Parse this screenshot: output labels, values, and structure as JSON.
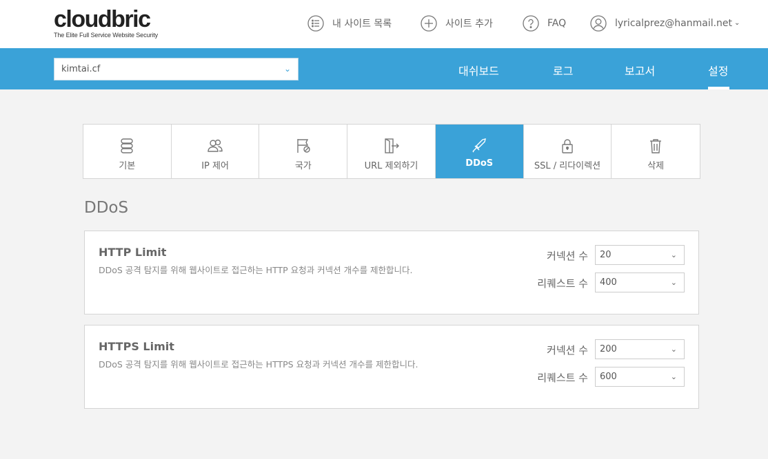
{
  "logo": {
    "word": "cloudbric",
    "tagline": "The Elite Full Service Website Security"
  },
  "top_nav": {
    "my_sites": "내 사이트 목록",
    "add_site": "사이트 추가",
    "faq": "FAQ",
    "user_email": "lyricalprez@hanmail.net"
  },
  "site_select": {
    "value": "kimtai.cf"
  },
  "main_nav": {
    "dashboard": "대쉬보드",
    "log": "로그",
    "report": "보고서",
    "settings": "설정"
  },
  "tabs": [
    {
      "label": "기본",
      "icon": "database-icon"
    },
    {
      "label": "IP 제어",
      "icon": "users-icon"
    },
    {
      "label": "국가",
      "icon": "flag-block-icon"
    },
    {
      "label": "URL 제외하기",
      "icon": "exit-door-icon"
    },
    {
      "label": "DDoS",
      "icon": "sword-icon",
      "active": true
    },
    {
      "label": "SSL / 리다이렉션",
      "icon": "lock-icon"
    },
    {
      "label": "삭제",
      "icon": "trash-icon"
    }
  ],
  "section_title": "DDoS",
  "panels": {
    "http": {
      "title": "HTTP Limit",
      "description": "DDoS 공격 탐지를 위해 웹사이트로 접근하는 HTTP 요청과 커넥션 개수를 제한합니다.",
      "connections_label": "커넥션 수",
      "connections_value": "20",
      "requests_label": "리퀘스트 수",
      "requests_value": "400"
    },
    "https": {
      "title": "HTTPS Limit",
      "description": "DDoS 공격 탐지를 위해 웹사이트로 접근하는 HTTPS 요청과 커넥션 개수를 제한합니다.",
      "connections_label": "커넥션 수",
      "connections_value": "200",
      "requests_label": "리퀘스트 수",
      "requests_value": "600"
    }
  },
  "colors": {
    "accent": "#3aa2d8",
    "background": "#f3f3f3"
  }
}
